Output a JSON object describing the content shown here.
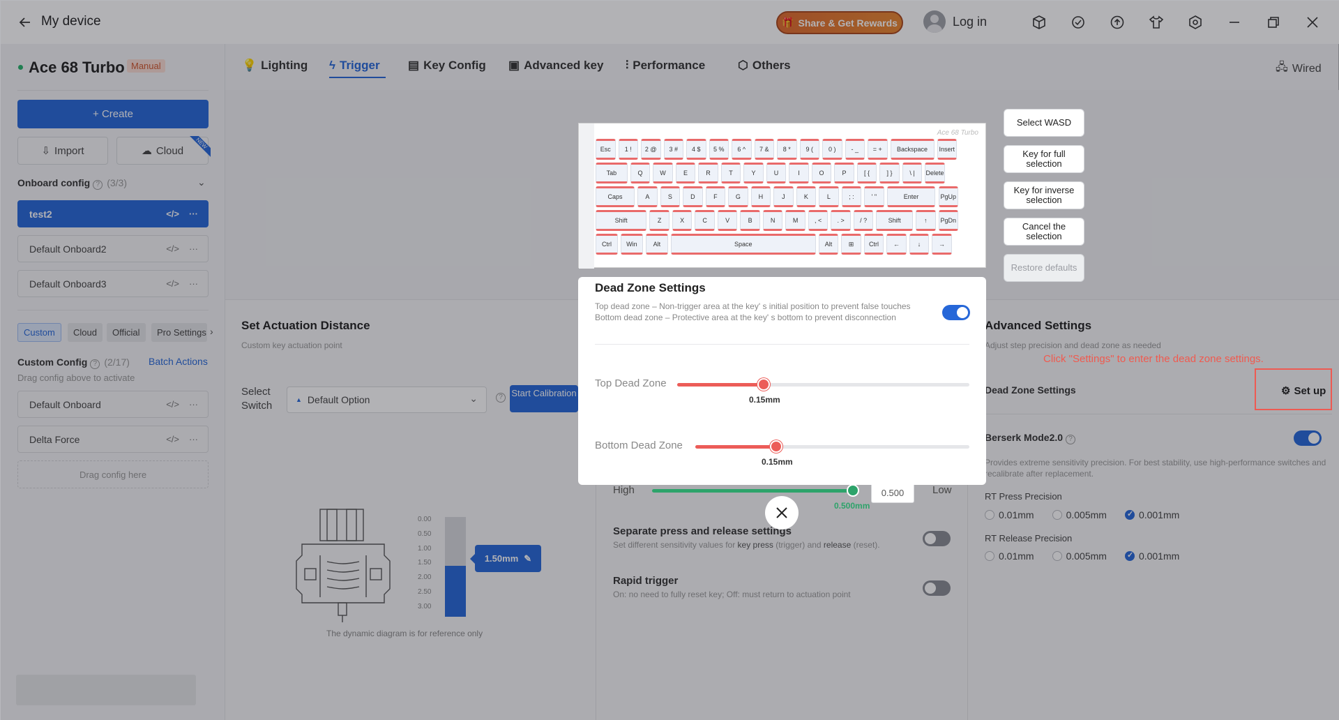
{
  "titlebar": {
    "back_icon": "arrow-left-icon",
    "title": "My device",
    "share_label": "Share & Get Rewards",
    "login_label": "Log in"
  },
  "device": {
    "name": "Ace 68 Turbo",
    "mode_badge": "Manual"
  },
  "sidebar": {
    "create_label": "+ Create",
    "import_label": "Import",
    "cloud_label": "Cloud",
    "new_tag": "NEW",
    "onboard_title": "Onboard config",
    "onboard_count": "(3/3)",
    "onboard_items": [
      "test2",
      "Default Onboard2",
      "Default Onboard3"
    ],
    "tabs": [
      "Custom",
      "Cloud",
      "Official",
      "Pro Settings"
    ],
    "custom_title": "Custom Config",
    "custom_count": "(2/17)",
    "batch_label": "Batch Actions",
    "drag_hint": "Drag config above to activate",
    "custom_items": [
      "Default Onboard",
      "Delta Force"
    ],
    "drag_here": "Drag config here"
  },
  "nav": {
    "tabs": [
      "Lighting",
      "Trigger",
      "Key Config",
      "Advanced key",
      "Performance",
      "Others"
    ],
    "connection": "Wired"
  },
  "actuation": {
    "title": "Set Actuation Distance",
    "subtitle": "Custom key actuation point",
    "select_label": "Select Switch",
    "select_value": "Default Option",
    "calib_label": "Start Calibration",
    "scale": [
      "0.00",
      "0.50",
      "1.00",
      "1.50",
      "2.00",
      "2.50",
      "3.00"
    ],
    "value_label": "1.50mm",
    "value": 1.5,
    "max": 3.0,
    "ref_text": "The dynamic diagram is for reference only"
  },
  "sensitivity": {
    "high_label": "High",
    "low_label": "Low",
    "box_value": "0.500",
    "value_label": "0.500mm",
    "separate_title": "Separate press and release settings",
    "separate_sub_a": "Set different sensitivity values for ",
    "separate_key_press": "key press",
    "separate_sub_b": " (trigger) and ",
    "separate_release": "release",
    "separate_sub_c": " (reset).",
    "rapid_title": "Rapid trigger",
    "rapid_sub": "On: no need to fully reset key; Off: must return to actuation point"
  },
  "advanced": {
    "title": "Advanced Settings",
    "subtitle": "Adjust step precision and dead zone as needed",
    "dead_zone_label": "Dead Zone Settings",
    "setup_label": "Set up",
    "annotation": "Click \"Settings\" to enter the dead zone settings.",
    "berserk_title": "Berserk Mode2.0",
    "berserk_sub": "Provides extreme sensitivity precision. For best stability, use high-performance switches and recalibrate after replacement.",
    "rt_press_title": "RT Press Precision",
    "rt_release_title": "RT Release Precision",
    "precision_options": [
      "0.01mm",
      "0.005mm",
      "0.001mm"
    ],
    "selected_index": 2
  },
  "keyboard": {
    "logo": "Ace 68 Turbo",
    "rows": [
      [
        "Esc",
        "1 !",
        "2 @",
        "3 #",
        "4 $",
        "5 %",
        "6 ^",
        "7 &",
        "8 *",
        "9 (",
        "0 )",
        "- _",
        "= +",
        "Backspace",
        "Insert"
      ],
      [
        "Tab",
        "Q",
        "W",
        "E",
        "R",
        "T",
        "Y",
        "U",
        "I",
        "O",
        "P",
        "[ {",
        "] }",
        "\\ |",
        "Delete"
      ],
      [
        "Caps",
        "A",
        "S",
        "D",
        "F",
        "G",
        "H",
        "J",
        "K",
        "L",
        "; :",
        "' \"",
        "Enter",
        "PgUp"
      ],
      [
        "Shift",
        "Z",
        "X",
        "C",
        "V",
        "B",
        "N",
        "M",
        ", <",
        ". >",
        "/ ?",
        "Shift",
        "↑",
        "PgDn"
      ],
      [
        "Ctrl",
        "Win",
        "Alt",
        "Space",
        "Alt",
        "⊞",
        "Ctrl",
        "←",
        "↓",
        "→"
      ]
    ]
  },
  "side_buttons": [
    "Select WASD",
    "Key for full selection",
    "Key for inverse selection",
    "Cancel the selection",
    "Restore defaults"
  ],
  "modal": {
    "title": "Dead Zone Settings",
    "desc_top": "Top dead zone – Non-trigger area at the key' s initial position to prevent false touches",
    "desc_bottom": "Bottom dead zone – Protective area at the key' s bottom to prevent disconnection",
    "top_label": "Top Dead Zone",
    "top_value": "0.15mm",
    "bottom_label": "Bottom Dead Zone",
    "bottom_value": "0.15mm"
  },
  "colors": {
    "accent": "#2667d8",
    "slider": "#ec5c58",
    "annotation": "#f05a4f",
    "green": "#2da36a"
  }
}
